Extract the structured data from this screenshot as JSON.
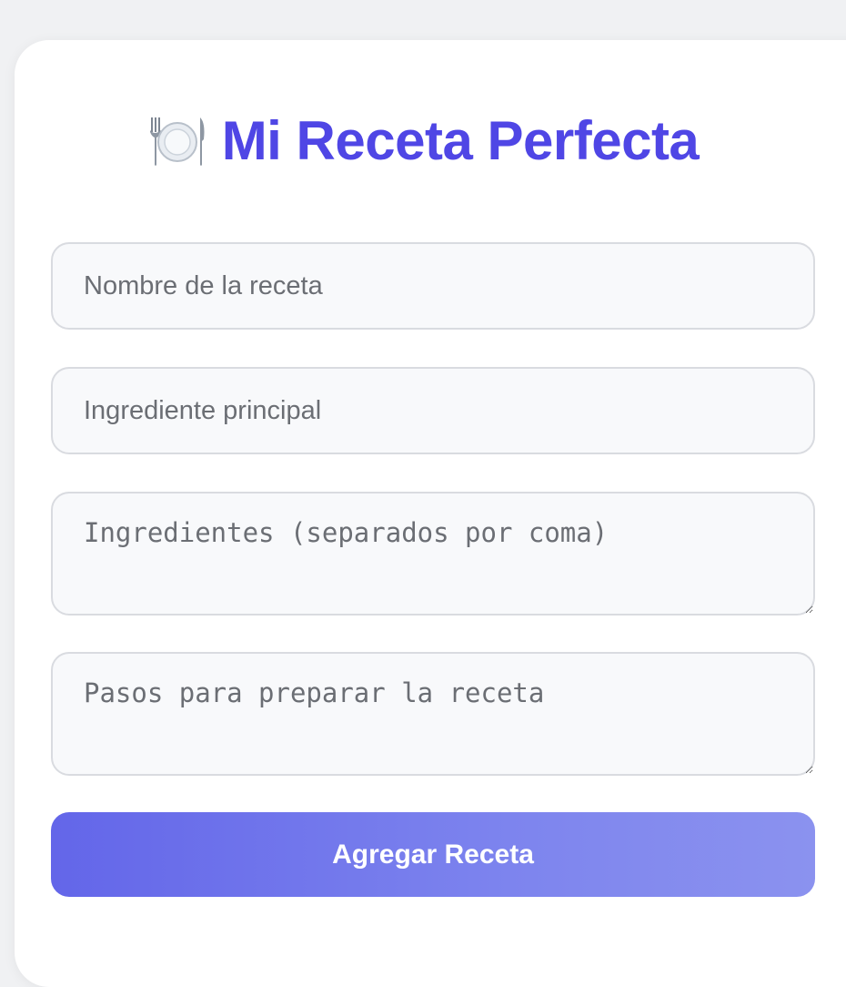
{
  "app": {
    "title": "Mi Receta Perfecta",
    "title_icon": "plate-with-cutlery-icon"
  },
  "form": {
    "recipe_name": {
      "value": "",
      "placeholder": "Nombre de la receta"
    },
    "main_ingredient": {
      "value": "",
      "placeholder": "Ingrediente principal"
    },
    "ingredients": {
      "value": "",
      "placeholder": "Ingredientes (separados por coma)"
    },
    "steps": {
      "value": "",
      "placeholder": "Pasos para preparar la receta"
    },
    "submit_label": "Agregar Receta"
  },
  "colors": {
    "accent": "#4f46e5",
    "button_gradient_start": "#6366e9",
    "button_gradient_end": "#8b92ef",
    "page_background": "#f0f1f3",
    "field_background": "#f8f9fb",
    "field_border": "#d9dbe0"
  }
}
